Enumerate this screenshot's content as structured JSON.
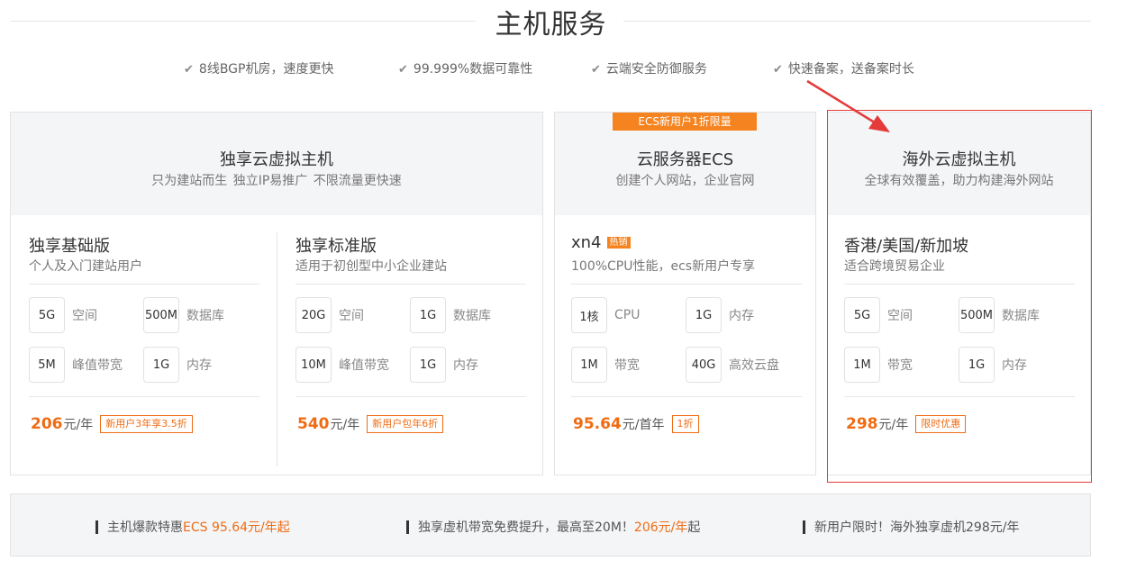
{
  "section_title": "主机服务",
  "features": [
    {
      "icon": "check-icon",
      "text": "8线BGP机房，速度更快"
    },
    {
      "icon": "check-icon",
      "text": "99.999%数据可靠性"
    },
    {
      "icon": "check-icon",
      "text": "云端安全防御服务"
    },
    {
      "icon": "check-icon",
      "text": "快速备案，送备案时长"
    }
  ],
  "cards": [
    {
      "title": "独享云虚拟主机",
      "subtitle": "只为建站而生    独立IP易推广    不限流量更快速",
      "plans": [
        {
          "name": "独享基础版",
          "desc": "个人及入门建站用户",
          "specs": [
            {
              "value": "5G",
              "label": "空间"
            },
            {
              "value": "500M",
              "label": "数据库"
            },
            {
              "value": "5M",
              "label": "峰值带宽"
            },
            {
              "value": "1G",
              "label": "内存"
            }
          ],
          "price": "206",
          "unit": "元/年",
          "tag": "新用户3年享3.5折"
        },
        {
          "name": "独享标准版",
          "desc": "适用于初创型中小企业建站",
          "specs": [
            {
              "value": "20G",
              "label": "空间"
            },
            {
              "value": "1G",
              "label": "数据库"
            },
            {
              "value": "10M",
              "label": "峰值带宽"
            },
            {
              "value": "1G",
              "label": "内存"
            }
          ],
          "price": "540",
          "unit": "元/年",
          "tag": "新用户包年6折"
        }
      ]
    },
    {
      "badge": "ECS新用户1折限量",
      "title": "云服务器ECS",
      "subtitle": "创建个人网站，企业官网",
      "plans": [
        {
          "name": "xn4",
          "hot": "热销",
          "desc": "100%CPU性能，ecs新用户专享",
          "specs": [
            {
              "value": "1核",
              "label": "CPU"
            },
            {
              "value": "1G",
              "label": "内存"
            },
            {
              "value": "1M",
              "label": "带宽"
            },
            {
              "value": "40G",
              "label": "高效云盘"
            }
          ],
          "price": "95.64",
          "unit": "元/首年",
          "tag": "1折"
        }
      ]
    },
    {
      "title": "海外云虚拟主机",
      "subtitle": "全球有效覆盖，助力构建海外网站",
      "plans": [
        {
          "name": "香港/美国/新加坡",
          "desc": "适合跨境贸易企业",
          "specs": [
            {
              "value": "5G",
              "label": "空间"
            },
            {
              "value": "500M",
              "label": "数据库"
            },
            {
              "value": "1M",
              "label": "带宽"
            },
            {
              "value": "1G",
              "label": "内存"
            }
          ],
          "price": "298",
          "unit": "元/年",
          "tag": "限时优惠"
        }
      ]
    }
  ],
  "notices": [
    {
      "pre": "主机爆款特惠",
      "hl": "ECS 95.64元/年起",
      "post": ""
    },
    {
      "pre": "独享虚机带宽免费提升，最高至20M！",
      "hl": "206元/年",
      "post": "起"
    },
    {
      "pre": "新用户限时！海外独享虚机298元/年",
      "hl": "",
      "post": ""
    }
  ],
  "colors": {
    "accent": "#f06c13",
    "badge": "#f5831f",
    "highlight": "#e43a3a"
  }
}
